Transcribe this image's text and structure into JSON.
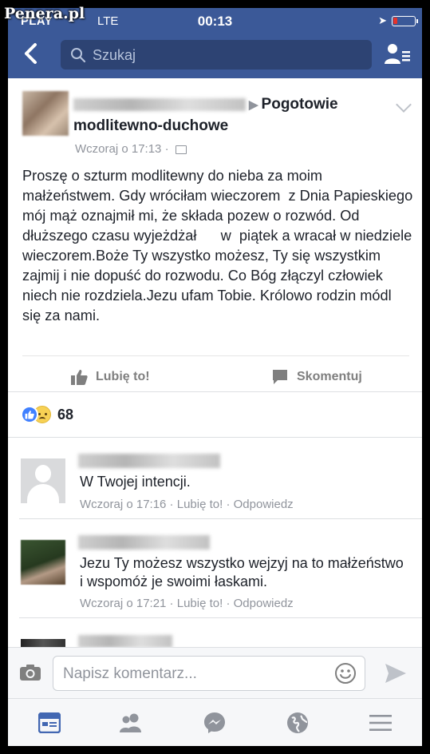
{
  "watermark": "Penera.pl",
  "status_bar": {
    "carrier": "PLAY",
    "network": "LTE",
    "time": "00:13"
  },
  "header": {
    "back_icon": "chevron-left-icon",
    "search_placeholder": "Szukaj",
    "friends_icon": "friend-list-icon",
    "brand_color": "#3b5998"
  },
  "post": {
    "group_name": "Pogotowie modlitewno-duchowe",
    "group_name_line1": "Pogotowie",
    "group_name_line2": "modlitewno-duchowe",
    "timestamp": "Wczoraj o 17:13",
    "body": "Proszę o szturm modlitewny do nieba za moim małżeństwem. Gdy wróciłam wieczorem  z Dnia Papieskiego mój mąż oznajmił mi, że składa pozew o rozwód. Od dłuższego czasu wyjeżdżał      w  piątek a wracał w niedziele wieczorem.Boże Ty wszystko możesz, Ty się wszystkim zajmij i nie dopuść do rozwodu. Co Bóg złączyl człowiek niech nie rozdziela.Jezu ufam Tobie. Królowo rodzin módl się za nami.",
    "like_label": "Lubię to!",
    "comment_label": "Skomentuj",
    "reaction_count": "68"
  },
  "comments": [
    {
      "text": "W Twojej intencji.",
      "time": "Wczoraj o 17:16",
      "like": "Lubię to!",
      "reply": "Odpowiedz"
    },
    {
      "text": "Jezu Ty możesz wszystko wejzyj na to małżeństwo i wspomóż je swoimi łaskami.",
      "time": "Wczoraj o 17:21",
      "like": "Lubię to!",
      "reply": "Odpowiedz"
    }
  ],
  "composer": {
    "placeholder": "Napisz komentarz..."
  },
  "tabbar": {
    "items": [
      "news-feed-icon",
      "friends-icon",
      "messenger-icon",
      "globe-icon",
      "menu-icon"
    ],
    "active_color": "#4267b2"
  }
}
